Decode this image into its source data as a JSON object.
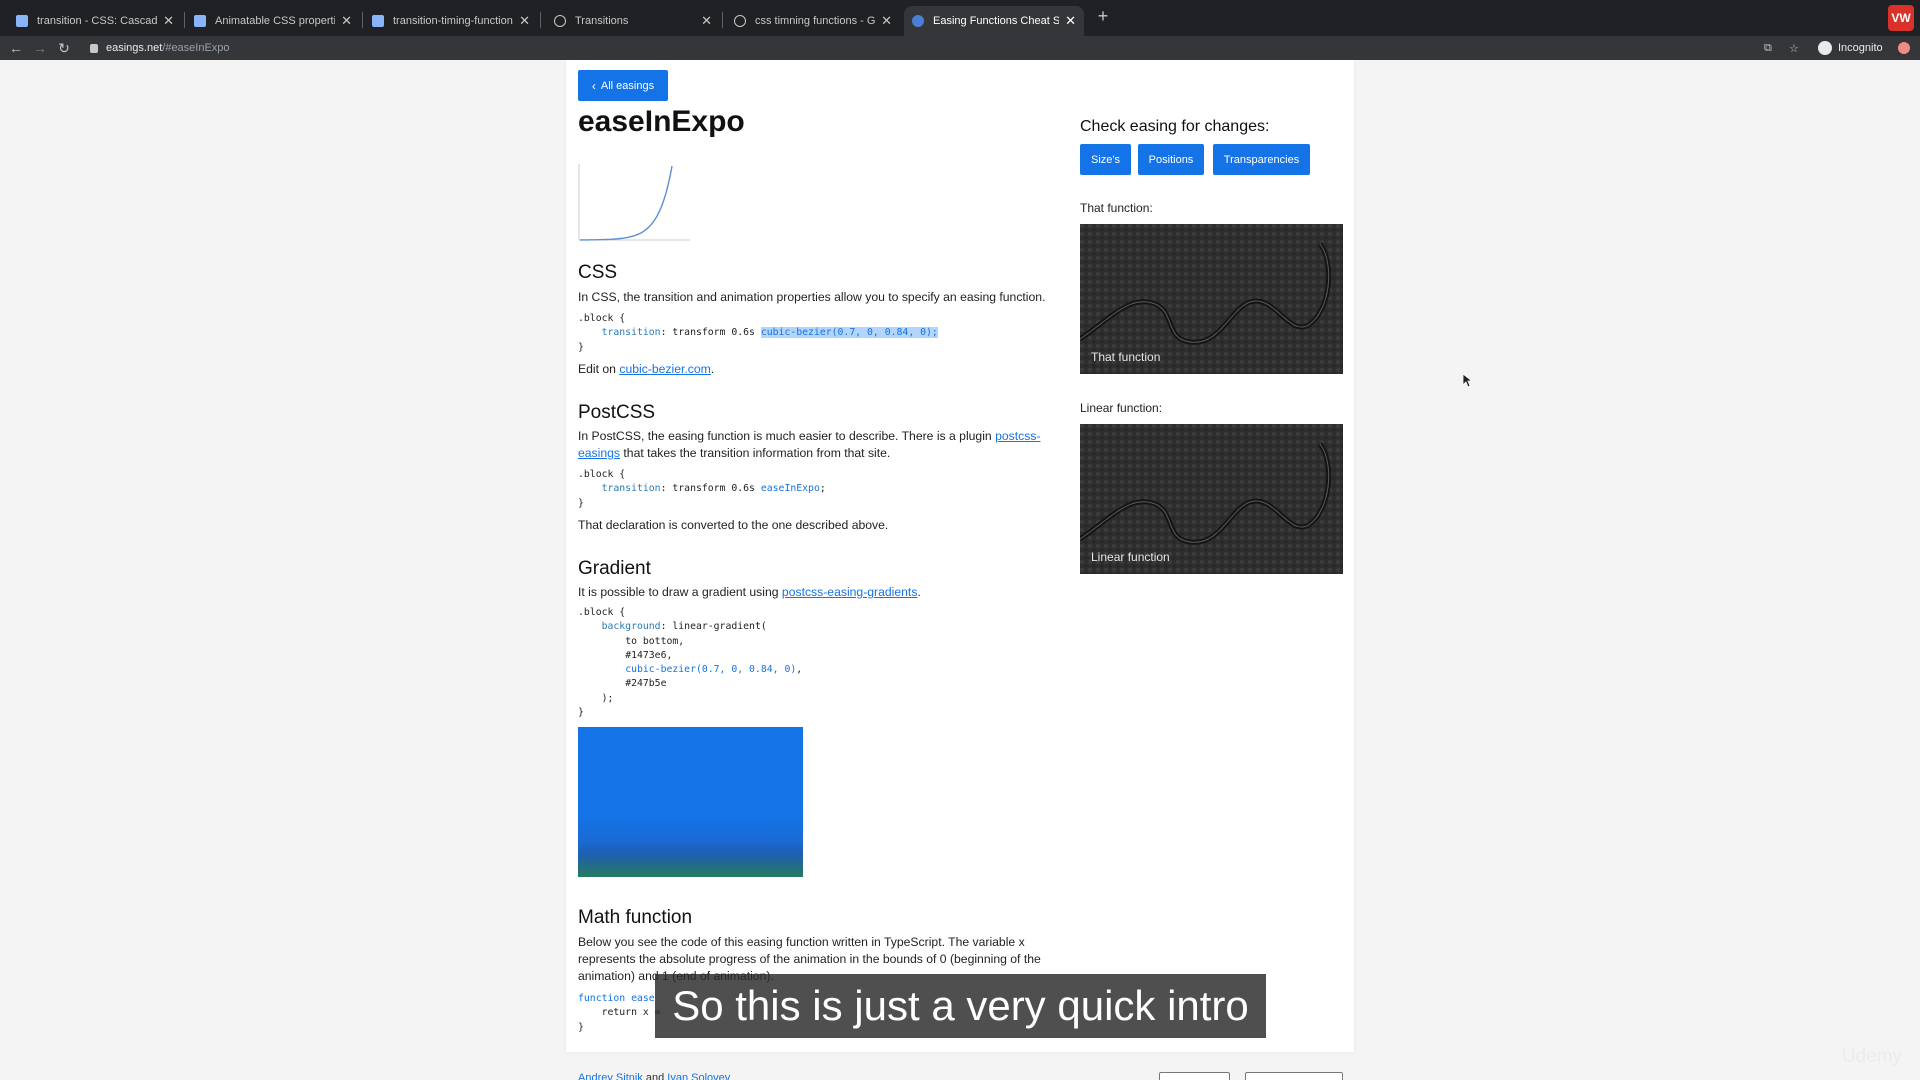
{
  "browser": {
    "tabs": [
      {
        "title": "transition - CSS: Cascading St",
        "active": false
      },
      {
        "title": "Animatable CSS properties - C",
        "active": false
      },
      {
        "title": "transition-timing-function - C",
        "active": false
      },
      {
        "title": "Transitions",
        "active": false
      },
      {
        "title": "css timning functions - Google",
        "active": false
      },
      {
        "title": "Easing Functions Cheat Sheet",
        "active": true
      }
    ],
    "new_tab": "+",
    "extension_label": "VW",
    "address": {
      "domain": "easings.net",
      "path": "/#easeInExpo"
    },
    "profile": "Incognito"
  },
  "page": {
    "back_button": "All easings",
    "title": "easeInExpo",
    "css": {
      "heading": "CSS",
      "text": "In CSS, the transition and animation properties allow you to specify an easing function.",
      "code_open": ".block {",
      "code_prop": "transition",
      "code_mid": ": transform 0.6s ",
      "code_value": "cubic-bezier(0.7, 0, 0.84, 0);",
      "code_close": "}",
      "edit_prefix": "Edit on ",
      "edit_link": "cubic-bezier.com",
      "edit_suffix": "."
    },
    "postcss": {
      "heading": "PostCSS",
      "text_a": "In PostCSS, the easing function is much easier to describe. There is a plugin ",
      "link": "postcss-easings",
      "text_b": " that takes the transition information from that site.",
      "code_open": ".block {",
      "code_prop": "transition",
      "code_mid": ": transform 0.6s ",
      "code_value": "easeInExpo",
      "code_end": ";",
      "code_close": "}",
      "after": "That declaration is converted to the one described above."
    },
    "gradient": {
      "heading": "Gradient",
      "text_a": "It is possible to draw a gradient using ",
      "link": "postcss-easing-gradients",
      "text_b": ".",
      "code_open": ".block {",
      "code_prop": "background",
      "code_mid": ": linear-gradient(",
      "line_dir": "to bottom,",
      "line_c1": "#1473e6,",
      "line_fn": "cubic-bezier(0.7, 0, 0.84, 0)",
      "line_fn_end": ",",
      "line_c2": "#247b5e",
      "line_close_paren": ");",
      "code_close": "}",
      "color_start": "#1473e6",
      "color_end": "#247b5e"
    },
    "math": {
      "heading": "Math function",
      "text": "Below you see the code of this easing function written in TypeScript. The variable x represents the absolute progress of the animation in the bounds of 0 (beginning of the animation) and 1 (end of animation).",
      "code_fn": "function ease",
      "code_ret": "return x =",
      "code_close": "}"
    },
    "sidebar": {
      "heading": "Check easing for changes:",
      "buttons": [
        "Size's",
        "Positions",
        "Transparencies"
      ],
      "that_label": "That function:",
      "that_caption": "That function",
      "linear_label": "Linear function:",
      "linear_caption": "Linear function"
    },
    "footer": {
      "author1": "Andrey Sitnik",
      "and": " and ",
      "author2": "Ivan Solovev"
    }
  },
  "overlay": {
    "subtitle": "So this is just a very quick intro",
    "watermark": "Udemy"
  },
  "colors": {
    "accent": "#1473e6",
    "chrome": "#202124",
    "toolbar": "#35363a"
  }
}
